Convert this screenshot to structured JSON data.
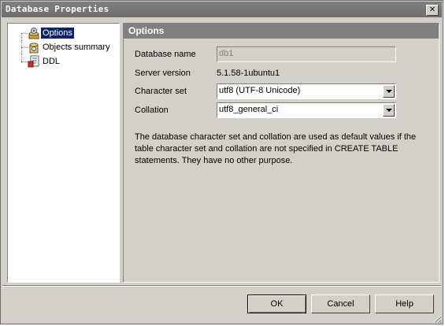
{
  "window": {
    "title": "Database Properties",
    "close_icon": "close-icon"
  },
  "tree": {
    "items": [
      {
        "label": "Options",
        "icon": "options-icon",
        "selected": true
      },
      {
        "label": "Objects summary",
        "icon": "objects-summary-icon",
        "selected": false
      },
      {
        "label": "DDL",
        "icon": "ddl-icon",
        "selected": false
      }
    ]
  },
  "panel": {
    "header": "Options",
    "database_name_label": "Database name",
    "database_name_value": "db1",
    "server_version_label": "Server version",
    "server_version_value": "5.1.58-1ubuntu1",
    "character_set_label": "Character set",
    "character_set_value": "utf8 (UTF-8 Unicode)",
    "collation_label": "Collation",
    "collation_value": "utf8_general_ci",
    "description": "The database character set and collation are used as default values if the table character set and collation are not specified in CREATE TABLE statements. They have no other purpose."
  },
  "buttons": {
    "ok": "OK",
    "cancel": "Cancel",
    "help": "Help"
  },
  "colors": {
    "title_bar": "#7a7a7a",
    "selection": "#0a246a",
    "section_header": "#808080",
    "face": "#d4d0c8"
  }
}
